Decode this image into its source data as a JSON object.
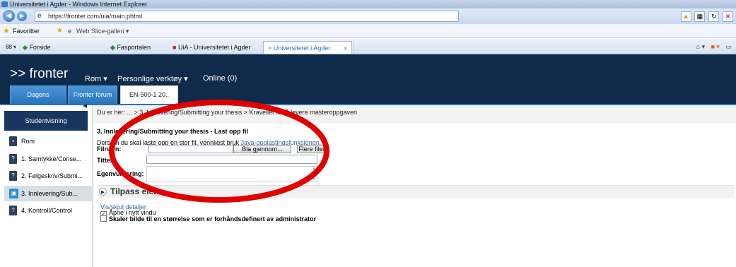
{
  "browser": {
    "window_title": "Universitetet i Agder - Windows Internet Explorer",
    "url": "https://fronter.com/uia/main.phtml",
    "favorites_label": "Favoritter",
    "web_slice_label": "Web Slice-galleri ▾",
    "tabs": [
      {
        "label": "Forside"
      },
      {
        "label": "Fasportalen"
      },
      {
        "label": "UiA - Universitetet i Agder"
      },
      {
        "label": "> Universitetet i Agder"
      }
    ],
    "tab_close": "x"
  },
  "fronter": {
    "logo": ">> fronter",
    "nav": [
      {
        "label": "Rom ▾"
      },
      {
        "label": "Personlige verktøy ▾"
      },
      {
        "label": "Online (0)"
      }
    ],
    "room_tabs": [
      {
        "label": "Dagens"
      },
      {
        "label": "Fronter forum"
      },
      {
        "label": "EN-500-1 20.."
      }
    ]
  },
  "sidebar": {
    "student_view": "Studentvisning",
    "items": [
      {
        "label": "Rom"
      },
      {
        "label": "1. Samtykke/Conse..."
      },
      {
        "label": "2. Følgeskriv/Submi..."
      },
      {
        "label": "3. Innlevering/Sub..."
      },
      {
        "label": "4. Kontroll/Control"
      }
    ]
  },
  "breadcrumb": "Du er her: ... > 3. Innlevering/Submitting your thesis > Kravelier for å levere masteroppgaven",
  "form": {
    "heading": "3. Innlevering/Submitting your thesis - Last opp fil",
    "hint_text": "Dersom du skal laste opp en stor fil, vennligst bruk ",
    "hint_link": "Java-opplastingsfunksjonen.",
    "filename_label": "Filnavn:",
    "browse_button": "Bla gjennom...",
    "more_files_button": "Flere filer",
    "title_label": "Tittel:",
    "title_value": "",
    "self_eval_label": "Egenvurdering:",
    "tilpass": "Tilpass eiere",
    "toggle_details": "Vis/skjul detaljer",
    "opt_new_window": "Åpne i nytt vindu",
    "opt_scale": "Skaler bilde til en størrelse som er forhåndsdefinert av administrator"
  },
  "colors": {
    "header_bg": "#0f2a4a",
    "tab_blue": "#2a73bb",
    "annotation_red": "#e00000",
    "link": "#2b5fa6"
  }
}
